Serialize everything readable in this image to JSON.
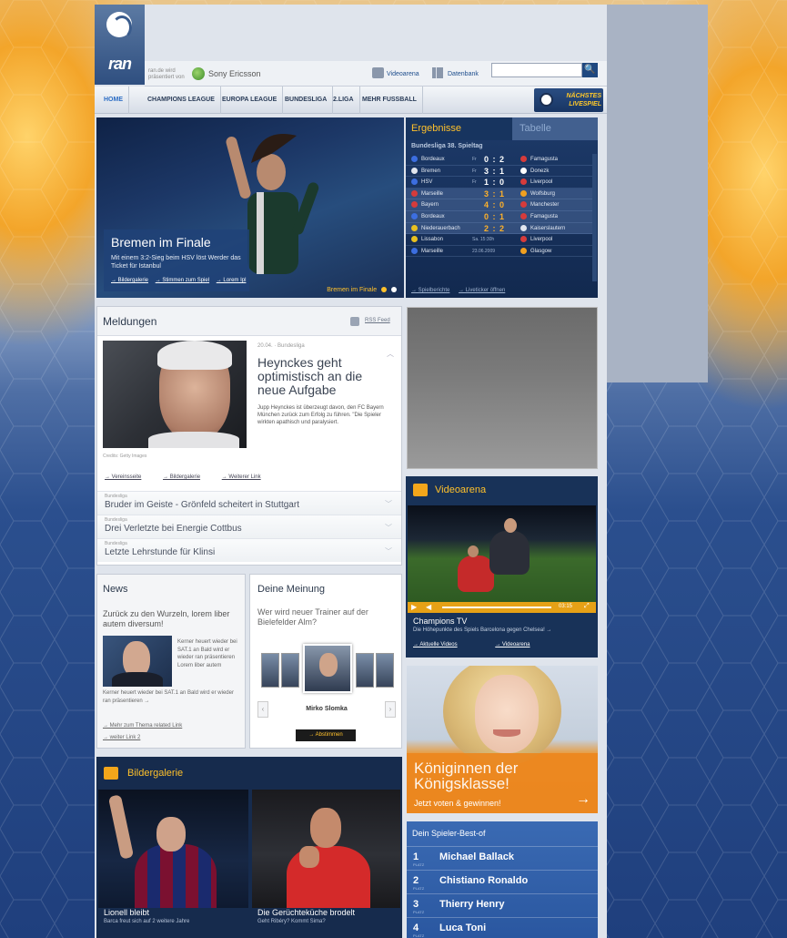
{
  "header": {
    "logo_text": "ran",
    "presented_by": "ran.de wird präsentiert von",
    "sponsor": "Sony Ericsson",
    "videoarena_link": "Videoarena",
    "datenbank_link": "Datenbank",
    "search_value": "",
    "search_button": "🔍"
  },
  "nav": {
    "items": [
      "HOME",
      "CHAMPIONS LEAGUE",
      "EUROPA LEAGUE",
      "BUNDESLIGA",
      "2.LIGA",
      "MEHR FUSSBALL"
    ],
    "next_match": "NÄCHSTES LIVESPIEL"
  },
  "hero": {
    "title": "Bremen im Finale",
    "text": "Mit einem 3:2-Sieg beim HSV löst Werder das Ticket für Istanbul",
    "links": [
      "→ Bildergalerie",
      "→ Stimmen zum Spiel",
      "→ Lorem Ipl"
    ],
    "pager_label": "Bremen im Finale"
  },
  "results": {
    "tab_results": "Ergebnisse",
    "tab_table": "Tabelle",
    "league": "Bundesliga 38. Spieltag",
    "rows": [
      {
        "home": "Bordeaux",
        "day": "Fr",
        "score": "0 : 2",
        "away": "Famagusta",
        "highlight": false,
        "orange": false
      },
      {
        "home": "Bremen",
        "day": "Fr",
        "score": "3 : 1",
        "away": "Donezk",
        "highlight": false,
        "orange": false
      },
      {
        "home": "HSV",
        "day": "Fr",
        "score": "1 : 0",
        "away": "Liverpool",
        "highlight": false,
        "orange": false
      },
      {
        "home": "Marseille",
        "day": "",
        "score": "3 : 1",
        "away": "Wolfsburg",
        "highlight": true,
        "orange": true
      },
      {
        "home": "Bayern",
        "day": "",
        "score": "4 : 0",
        "away": "Manchester",
        "highlight": true,
        "orange": true
      },
      {
        "home": "Bordeaux",
        "day": "",
        "score": "0 : 1",
        "away": "Famagusta",
        "highlight": true,
        "orange": true
      },
      {
        "home": "Niederauerbach",
        "day": "",
        "score": "2 : 2",
        "away": "Kaiserslautern",
        "highlight": true,
        "orange": true
      },
      {
        "home": "Lissabon",
        "day": "Sa. 15:30h",
        "score": "",
        "away": "Liverpool",
        "highlight": false,
        "orange": false
      },
      {
        "home": "Marseille",
        "day": "23.06.2009",
        "score": "",
        "away": "Glasgow",
        "highlight": false,
        "orange": false
      }
    ],
    "footer_links": [
      "→ Spielberichte",
      "→ Liveticker öffnen"
    ]
  },
  "meldungen": {
    "title": "Meldungen",
    "rss": "RSS Feed",
    "photo_credit": "Credits: Getty Images",
    "meta": "20.04. · Bundesliga",
    "headline": "Heynckes geht optimistisch an die neue Aufgabe",
    "teaser": "Jupp Heynckes ist überzeugt davon, den FC Bayern München zurück zum Erfolg zu führen. \"Die Spieler wirkten apathisch und paralysiert.",
    "links": [
      "→ Vereinsseite",
      "→ Bildergalerie",
      "→ Weiterer Link"
    ],
    "items": [
      {
        "category": "Bundesliga",
        "title": "Bruder im Geiste - Grönfeld scheitert in Stuttgart"
      },
      {
        "category": "Bundesliga",
        "title": "Drei Verletzte bei Energie Cottbus"
      },
      {
        "category": "Bundesliga",
        "title": "Letzte Lehrstunde für Klinsi"
      }
    ]
  },
  "videoarena": {
    "title": "Videoarena",
    "time": "03:15",
    "show": "Champions TV",
    "desc": "Die Höhepunkte des Spiels Barcelona gegen Chelsea! →",
    "links": [
      "→ Aktuelle Videos",
      "→ Videoarena"
    ]
  },
  "news": {
    "title": "News",
    "headline": "Zurück zu den Wurzeln, lorem liber autem diversum!",
    "side_text": "Kerner heuert wieder bei SAT.1 an Bald wird er wieder ran präsentieren Lorem liber autem",
    "body": "Kerner heuert wieder bei SAT.1 an Bald wird er wieder ran präsentieren →",
    "link1": "→ Mehr zum Thema related Link",
    "link2": "→ weiter Link 2"
  },
  "meinung": {
    "title": "Deine Meinung",
    "question": "Wer wird neuer Trainer auf der Bielefelder Alm?",
    "candidate": "Mirko Slomka",
    "vote": "→ Abstimmen",
    "prev": "‹",
    "next": "›"
  },
  "queens_ad": {
    "title": "Königinnen der Königsklasse!",
    "cta": "Jetzt voten & gewinnen!",
    "arrow": "→"
  },
  "spieler": {
    "title": "Dein Spieler-Best-of",
    "platz_label": "PLATZ",
    "players": [
      {
        "rank": "1",
        "name": "Michael Ballack"
      },
      {
        "rank": "2",
        "name": "Chistiano Ronaldo"
      },
      {
        "rank": "3",
        "name": "Thierry Henry"
      },
      {
        "rank": "4",
        "name": "Luca Toni"
      }
    ]
  },
  "galerie": {
    "title": "Bildergalerie",
    "items": [
      {
        "caption": "Lionell bleibt",
        "sub": "Barca freut sich auf 2 weitere Jahre"
      },
      {
        "caption": "Die Gerüchteküche brodelt",
        "sub": "Geht Ribéry? Kommt Sima?"
      }
    ]
  },
  "colors": {
    "accent": "#ffc12b",
    "navy": "#183258",
    "orange": "#e68a26",
    "blue": "#2a57a0"
  }
}
